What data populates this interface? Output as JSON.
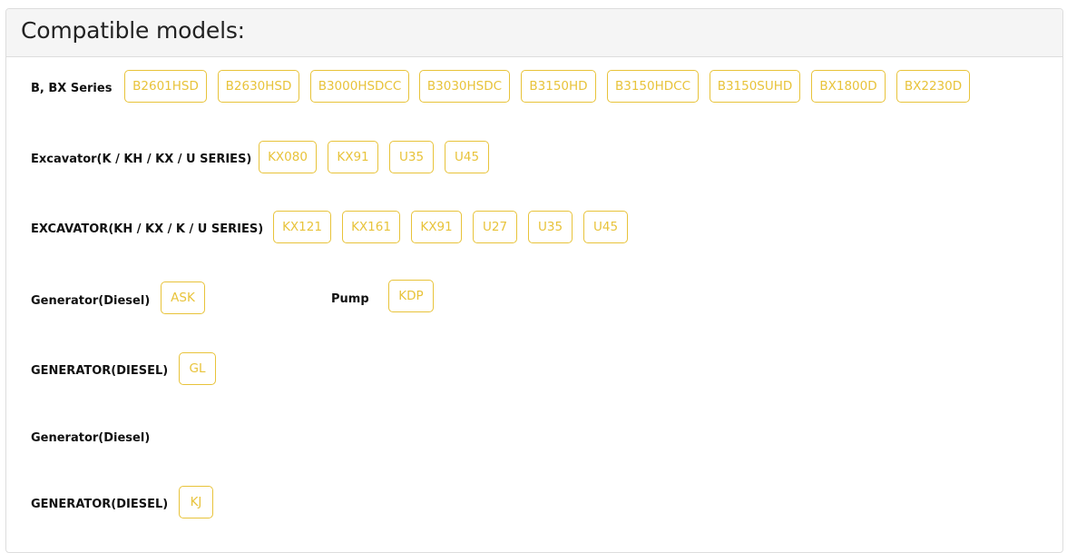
{
  "title": "Compatible models:",
  "groups": [
    {
      "label": "B, BX Series",
      "models": [
        "B2601HSD",
        "B2630HSD",
        "B3000HSDCC",
        "B3030HSDC",
        "B3150HD",
        "B3150HDCC",
        "B3150SUHD",
        "BX1800D",
        "BX2230D"
      ]
    },
    {
      "label": "Excavator(K / KH / KX / U SERIES)",
      "models": [
        "KX080",
        "KX91",
        "U35",
        "U45"
      ]
    },
    {
      "label": "EXCAVATOR(KH / KX / K / U SERIES)",
      "models": [
        "KX121",
        "KX161",
        "KX91",
        "U27",
        "U35",
        "U45"
      ]
    },
    {
      "label": "Generator(Diesel)",
      "models": [
        "ASK"
      ]
    },
    {
      "label": "Pump",
      "models": [
        "KDP"
      ]
    },
    {
      "label": "GENERATOR(DIESEL)",
      "models": [
        "GL"
      ]
    },
    {
      "label": "Generator(Diesel)",
      "models": []
    },
    {
      "label": "GENERATOR(DIESEL)",
      "models": [
        "KJ"
      ]
    }
  ]
}
